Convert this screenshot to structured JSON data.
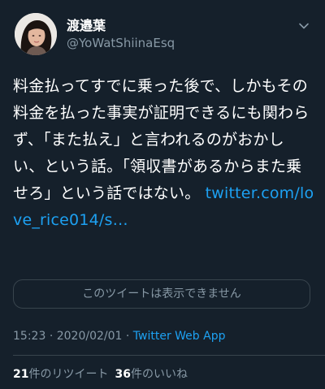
{
  "user": {
    "display_name": "渡邉葉",
    "handle": "@YoWatShiinaEsq"
  },
  "tweet": {
    "text": "料金払ってすでに乗った後で、しかもその料金を払った事実が証明できるにも関わらず、「また払え」と言われるのがおかしい、という話。「領収書があるからまた乗せろ」という話ではない。 ",
    "link_text": "twitter.com/love_rice014/s…",
    "quoted_unavailable": "このツイートは表示できません"
  },
  "meta": {
    "time": "15:23",
    "date": "2020/02/01",
    "separator": "·",
    "source_app": "Twitter Web App"
  },
  "stats": {
    "retweets_count": "21",
    "retweets_label": "件のリツイート",
    "likes_count": "36",
    "likes_label": "件のいいね"
  },
  "icons": {
    "caret": "chevron-down-icon",
    "avatar": "profile-photo"
  },
  "colors": {
    "background": "#15202b",
    "accent": "#1da1f2",
    "secondary_text": "#8899a6",
    "border": "#38444d"
  }
}
